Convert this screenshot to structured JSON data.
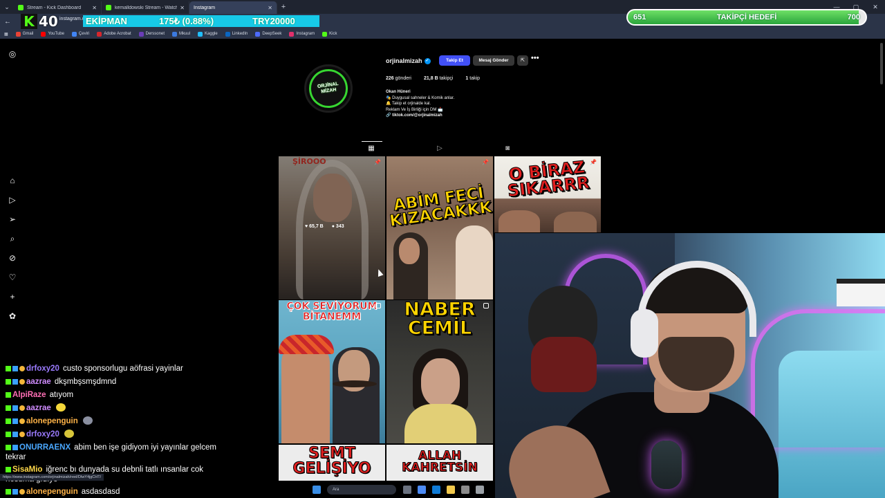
{
  "browser": {
    "tabs": [
      {
        "label": "Stream - Kick Dashboard",
        "icon": "kick-icon",
        "active": false
      },
      {
        "label": "kemalldowski Stream - Watch L",
        "icon": "kick-icon",
        "active": false
      },
      {
        "label": "Instagram",
        "icon": "instagram-icon",
        "active": true
      }
    ],
    "new_tab": "+",
    "url": "instagram.com",
    "bookmarks": [
      {
        "label": "Gmail",
        "color": "#ea4335"
      },
      {
        "label": "YouTube",
        "color": "#ff0000"
      },
      {
        "label": "Çeviri",
        "color": "#4285f4"
      },
      {
        "label": "Adobe Acrobat",
        "color": "#d7262c"
      },
      {
        "label": "Derssonet",
        "color": "#6a3db8"
      },
      {
        "label": "Mkuul",
        "color": "#3c7ae0"
      },
      {
        "label": "Kaggle",
        "color": "#20beff"
      },
      {
        "label": "LinkedIn",
        "color": "#0a66c2"
      },
      {
        "label": "DeepSeek",
        "color": "#4d6bfe"
      },
      {
        "label": "Instagram",
        "color": "#e1306c"
      },
      {
        "label": "Kick",
        "color": "#53fc18"
      }
    ]
  },
  "overlay": {
    "kick_count": "40",
    "ticker": {
      "item": "EKİPMAN",
      "price": "175₺ (0.88%)",
      "total": "TRY20000"
    },
    "goal": {
      "start": "651",
      "title": "TAKİPÇİ HEDEFİ",
      "end": "700",
      "progress": 0.97
    }
  },
  "profile": {
    "username": "orjinalmizah",
    "avatar_text": [
      "ORJİNAL",
      "MİZAH"
    ],
    "follow_label": "Takip Et",
    "message_label": "Mesaj Gönder",
    "stats": {
      "posts": "226",
      "posts_label": "gönderi",
      "followers": "21,8 B",
      "followers_label": "takipçi",
      "following": "1",
      "following_label": "takip"
    },
    "bio": {
      "name": "Okan Hüneri",
      "lines": [
        "🎭 Duygusal sahneler & Komik anlar.",
        "🔔 Takip et orjinalde kal.",
        "Reklam Ve İş Birliği için DM 📩"
      ],
      "link": "🔗 tiktok.com/@orjinalmizah"
    }
  },
  "posts": [
    {
      "title": "ŞİROOO",
      "likes": "65,7 B",
      "comments": "343"
    },
    {
      "title": "ABİM FECİ KIZACAKKK"
    },
    {
      "title": "O BİRAZ SIKARRR"
    },
    {
      "title": "ÇOK SEVİYORUM BİTANEMM"
    },
    {
      "title": "NABER CEMİL"
    },
    {
      "title": "SEMT GELİŞİYO"
    },
    {
      "title": "ALLAH KAHRETSİN"
    }
  ],
  "chat": [
    {
      "user": "drfoxy20",
      "color": "#9b7bff",
      "text": "custo sponsorlugu aöfrasi yayinlar"
    },
    {
      "user": "aazrae",
      "color": "#d08cff",
      "text": "dkşmbşsmşdmnd"
    },
    {
      "user": "AlpiRaze",
      "color": "#ff6fb5",
      "text": "atıyom"
    },
    {
      "user": "aazrae",
      "color": "#d08cff",
      "text": ""
    },
    {
      "user": "alonepenguin",
      "color": "#ffb347",
      "text": ""
    },
    {
      "user": "drfoxy20",
      "color": "#9b7bff",
      "text": ""
    },
    {
      "user": "ONURRAENX",
      "color": "#4aa8ff",
      "text": "abim ben işe gidiyom iyi yayınlar gelcem tekrar"
    },
    {
      "user": "SisaMio",
      "color": "#ffd84a",
      "text": "iğrenc bı dunyada su debnli tatlı ınsanlar cok hosuma gıdıyo"
    },
    {
      "user": "alonepenguin",
      "color": "#ffb347",
      "text": "asdasdasd"
    }
  ],
  "status_url": "https://www.instagram.com/orjinalmizah/reel/DIwY4jgCHT/",
  "taskbar": {
    "search_placeholder": "Ara"
  }
}
